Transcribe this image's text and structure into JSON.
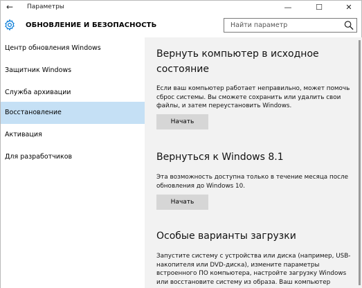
{
  "window": {
    "title": "Параметры",
    "back_glyph": "←",
    "minimize_glyph": "—",
    "maximize_glyph": "☐",
    "close_glyph": "✕"
  },
  "header": {
    "title": "ОБНОВЛЕНИЕ И БЕЗОПАСНОСТЬ",
    "icon": "gear-icon",
    "search": {
      "placeholder": "Найти параметр",
      "value": "",
      "icon": "search-icon"
    }
  },
  "sidebar": {
    "items": [
      {
        "label": "Центр обновления Windows",
        "active": false
      },
      {
        "label": "Защитник Windows",
        "active": false
      },
      {
        "label": "Служба архивации",
        "active": false
      },
      {
        "label": "Восстановление",
        "active": true
      },
      {
        "label": "Активация",
        "active": false
      },
      {
        "label": "Для разработчиков",
        "active": false
      }
    ]
  },
  "content": {
    "sections": [
      {
        "title": "Вернуть компьютер в исходное состояние",
        "text": "Если ваш компьютер работает неправильно, может помочь сброс системы. Вы сможете сохранить или удалить свои файлы, и затем переустановить Windows.",
        "button": "Начать"
      },
      {
        "title": "Вернуться к Windows 8.1",
        "text": "Эта возможность доступна только в течение месяца после обновления до Windows 10.",
        "button": "Начать"
      },
      {
        "title": "Особые варианты загрузки",
        "text": "Запустите систему с устройства или диска (например, USB-накопителя или DVD-диска), измените параметры встроенного ПО компьютера, настройте загрузку Windows или восстановите систему из образа. Ваш компьютер"
      }
    ]
  },
  "colors": {
    "accent": "#0078d7",
    "active_nav": "#c5e0f5",
    "content_bg": "#f2f2f2",
    "button_bg": "#d6d6d6"
  }
}
